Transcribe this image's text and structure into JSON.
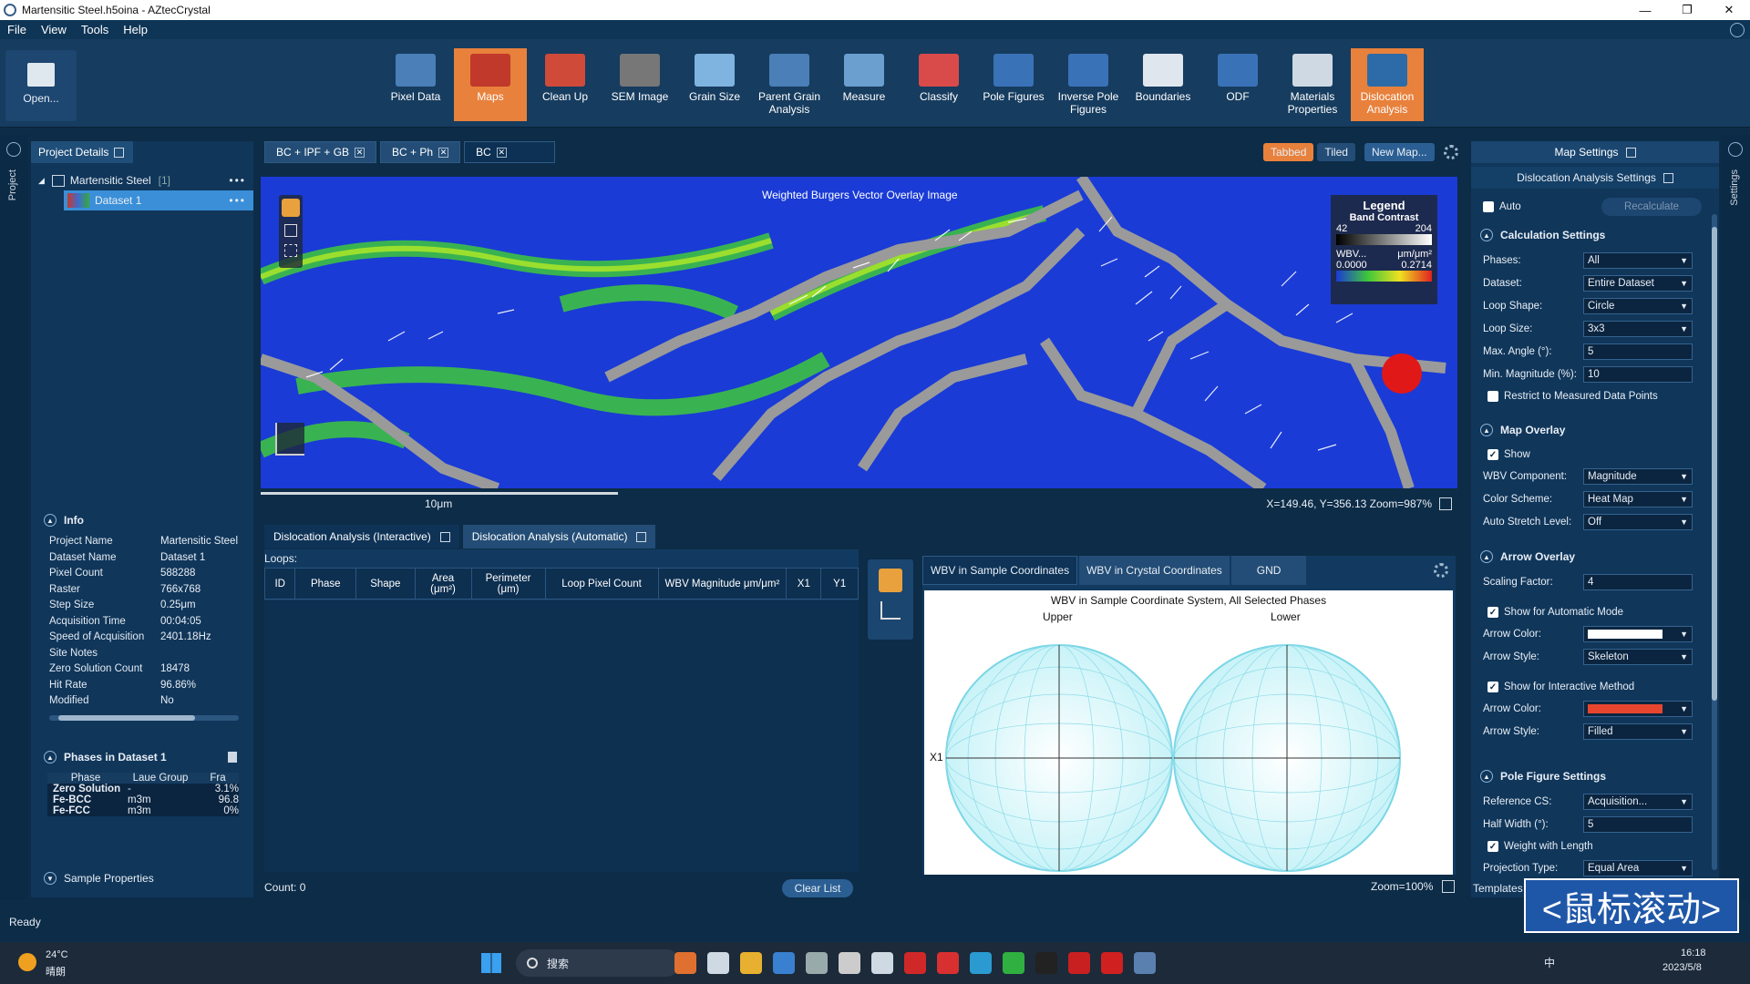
{
  "window": {
    "title": "Martensitic Steel.h5oina - AZtecCrystal"
  },
  "menu": [
    "File",
    "View",
    "Tools",
    "Help"
  ],
  "toolbar": {
    "open": "Open...",
    "items": [
      {
        "label": "Pixel Data",
        "icon": "pixel-data-icon"
      },
      {
        "label": "Maps",
        "icon": "maps-icon",
        "active": true
      },
      {
        "label": "Clean Up",
        "icon": "clean-up-icon"
      },
      {
        "label": "SEM Image",
        "icon": "sem-image-icon"
      },
      {
        "label": "Grain Size",
        "icon": "grain-size-icon"
      },
      {
        "label": "Parent Grain Analysis",
        "icon": "parent-grain-icon"
      },
      {
        "label": "Measure",
        "icon": "measure-icon"
      },
      {
        "label": "Classify",
        "icon": "classify-icon"
      },
      {
        "label": "Pole Figures",
        "icon": "pole-figures-icon"
      },
      {
        "label": "Inverse Pole Figures",
        "icon": "inverse-pole-figures-icon"
      },
      {
        "label": "Boundaries",
        "icon": "boundaries-icon"
      },
      {
        "label": "ODF",
        "icon": "odf-icon"
      },
      {
        "label": "Materials Properties",
        "icon": "materials-properties-icon"
      },
      {
        "label": "Dislocation Analysis",
        "icon": "dislocation-analysis-icon",
        "active": true
      }
    ]
  },
  "left": {
    "rail_label": "Project",
    "project_details": "Project Details",
    "project_name": "Martensitic Steel",
    "project_count": "[1]",
    "dataset": "Dataset 1",
    "info_title": "Info",
    "info": [
      {
        "k": "Project Name",
        "v": "Martensitic Steel"
      },
      {
        "k": "Dataset Name",
        "v": "Dataset 1"
      },
      {
        "k": "Pixel Count",
        "v": "588288"
      },
      {
        "k": "Raster",
        "v": "766x768"
      },
      {
        "k": "Step Size",
        "v": "0.25μm"
      },
      {
        "k": "Acquisition Time",
        "v": "00:04:05"
      },
      {
        "k": "Speed of Acquisition",
        "v": "2401.18Hz"
      },
      {
        "k": "Site Notes",
        "v": ""
      },
      {
        "k": "Zero Solution Count",
        "v": "18478"
      },
      {
        "k": "Hit Rate",
        "v": "96.86%"
      },
      {
        "k": "Modified",
        "v": "No"
      }
    ],
    "phases_title": "Phases in Dataset 1",
    "phase_headers": [
      "Phase",
      "Laue Group",
      "Fra"
    ],
    "phases": [
      {
        "name": "Zero Solution",
        "laue": "-",
        "frac": "3.1%"
      },
      {
        "name": "Fe-BCC",
        "laue": "m3m",
        "frac": "96.8"
      },
      {
        "name": "Fe-FCC",
        "laue": "m3m",
        "frac": "0%"
      }
    ],
    "sample_properties": "Sample Properties"
  },
  "map_tabs": [
    {
      "label": "BC + IPF + GB"
    },
    {
      "label": "BC + Ph"
    },
    {
      "label": "BC",
      "selected": true
    }
  ],
  "view_modes": {
    "tabbed": "Tabbed",
    "tiled": "Tiled",
    "new_map": "New Map..."
  },
  "map": {
    "title": "Weighted Burgers Vector Overlay Image",
    "scale_label": "10μm",
    "coords": "X=149.46, Y=356.13 Zoom=987%",
    "legend": {
      "title": "Legend",
      "bc_label": "Band Contrast",
      "bc_min": "42",
      "bc_max": "204",
      "wbv_label": "WBV...",
      "wbv_unit": "μm/μm²",
      "wbv_min": "0.0000",
      "wbv_max": "0.2714"
    }
  },
  "bottom": {
    "tabs": [
      "Dislocation Analysis (Interactive)",
      "Dislocation Analysis (Automatic)"
    ],
    "loops_label": "Loops:",
    "columns": [
      "ID",
      "Phase",
      "Shape",
      "Area (μm²)",
      "Perimeter (μm)",
      "Loop Pixel Count",
      "WBV Magnitude μm/μm²",
      "X1",
      "Y1"
    ],
    "count": "Count: 0",
    "clear": "Clear List",
    "pf_tabs": [
      "WBV in Sample Coordinates",
      "WBV in Crystal Coordinates",
      "GND"
    ],
    "pf_title": "WBV in Sample Coordinate System, All Selected Phases",
    "upper": "Upper",
    "lower": "Lower",
    "x1": "X1",
    "zoom": "Zoom=100%"
  },
  "settings": {
    "rail_label": "Settings",
    "map_settings": "Map Settings",
    "dislocation_settings": "Dislocation Analysis Settings",
    "auto": "Auto",
    "recalculate": "Recalculate",
    "calc_title": "Calculation Settings",
    "phases_lbl": "Phases:",
    "phases_val": "All",
    "dataset_lbl": "Dataset:",
    "dataset_val": "Entire Dataset",
    "loop_shape_lbl": "Loop Shape:",
    "loop_shape_val": "Circle",
    "loop_size_lbl": "Loop Size:",
    "loop_size_val": "3x3",
    "max_angle_lbl": "Max. Angle (°):",
    "max_angle_val": "5",
    "min_mag_lbl": "Min. Magnitude (%):",
    "min_mag_val": "10",
    "restrict": "Restrict to Measured Data Points",
    "overlay_title": "Map Overlay",
    "show": "Show",
    "wbv_comp_lbl": "WBV Component:",
    "wbv_comp_val": "Magnitude",
    "scheme_lbl": "Color Scheme:",
    "scheme_val": "Heat Map",
    "stretch_lbl": "Auto Stretch Level:",
    "stretch_val": "Off",
    "arrow_title": "Arrow Overlay",
    "scaling_lbl": "Scaling Factor:",
    "scaling_val": "4",
    "show_auto": "Show for Automatic Mode",
    "arrow_color_lbl": "Arrow Color:",
    "arrow_style_lbl": "Arrow Style:",
    "arrow_style_auto": "Skeleton",
    "show_inter": "Show for Interactive Method",
    "arrow_style_inter": "Filled",
    "pf_settings_title": "Pole Figure Settings",
    "ref_cs_lbl": "Reference CS:",
    "ref_cs_val": "Acquisition...",
    "half_width_lbl": "Half Width (°):",
    "half_width_val": "5",
    "weight": "Weight with Length",
    "proj_lbl": "Projection Type:",
    "proj_val": "Equal Area",
    "templates": "Templates",
    "auto_arrow_color": "#ffffff",
    "inter_arrow_color": "#e8452e"
  },
  "status": "Ready",
  "overlay_caption": "<鼠标滚动>",
  "taskbar": {
    "weather_temp": "24°C",
    "weather_desc": "晴朗",
    "search": "搜索",
    "ime": "中",
    "time": "16:18",
    "date": "2023/5/8"
  }
}
